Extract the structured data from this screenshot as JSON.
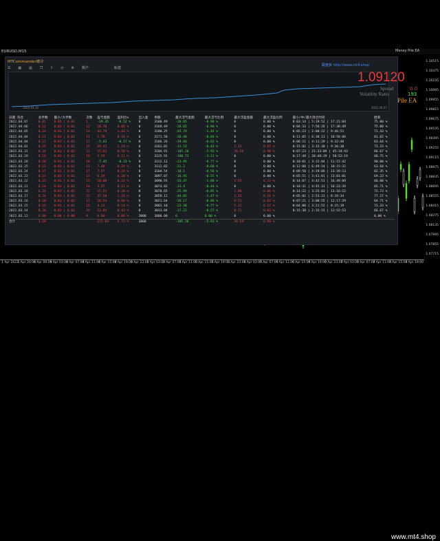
{
  "window": {
    "symbol_title": "EURUSD,M15",
    "ea_title": "Money Pile EA"
  },
  "panel": {
    "title": "MTCommander统计",
    "toolbar": [
      "账户",
      "轨迹"
    ],
    "mini_chart_start": "2022.03.14",
    "mini_chart_end": "2022.04.07",
    "link_text": "跟盘板 http://www.mt4.shop"
  },
  "ea_overlay": {
    "price": "1.09120",
    "spread_label": "Spread",
    "spread_value": "0.0",
    "volatility_label": "Volatility Ratio",
    "volatility_value": "193",
    "name": "Pile EA"
  },
  "table": {
    "headers": [
      "日期\n符合",
      "总手数",
      "最小/大手数",
      "次数",
      "盈亏金额",
      "盈利比%",
      "出入金",
      "余额",
      "最大浮亏金额",
      "最大浮亏比例",
      "最大浮盈金额",
      "最大浮盈比例",
      "最小/中/最大持仓时间",
      "胜率"
    ],
    "rows": [
      [
        "2022.04.07",
        "0.01",
        "0.01 | 0.01",
        "1",
        "-19.45",
        "-0.52 %",
        "0",
        "3180.49",
        "-28.65",
        "-0.90 %",
        "0",
        "0.00 %",
        "0:03:14 | 5:19:52 | 17:21:04",
        "75.00 %"
      ],
      [
        "2022.04.06",
        "0.12",
        "0.01 | 0.01",
        "12",
        "28.70",
        "0.86 %",
        "0",
        "3169.49",
        "-28.65",
        "-0.90 %",
        "0",
        "0.00 %",
        "0:04:33 | 7:56:26 | 17:38:49",
        "75.00 %"
      ],
      [
        "2022.04.05",
        "0.14",
        "0.01 | 0.01",
        "14",
        "44.79",
        "1.43 %",
        "0",
        "3180.25",
        "-45.79",
        "-1.44 %",
        "0",
        "0.00 %",
        "0:05:23 | 2:08:22 | 9:46:51",
        "71.43 %"
      ],
      [
        "2022.04.04",
        "0.11",
        "0.01 | 0.01",
        "11",
        "5.78",
        "0.18 %",
        "0",
        "3171.58",
        "-26.48",
        "-0.84 %",
        "0",
        "0.00 %",
        "0:11:05 | 6:38:13 | 18:50:06",
        "81.82 %"
      ],
      [
        "2022.04.04",
        "0.11",
        "0.01 | 0.01",
        "11",
        "-5.43",
        "-0.17 %",
        "0",
        "3166.26",
        "-19.66",
        "-0.62 %",
        "0",
        "0.00 %",
        "0:06:11 | 4:11:29 | 9:32:40",
        "63.64 %"
      ],
      [
        "2022.04.01",
        "0.15",
        "0.01 | 0.01",
        "15",
        "69.42",
        "2.19 %",
        "0",
        "3161.02",
        "-13.53",
        "-0.43 %",
        "2.15",
        "0.07 %",
        "0:15:01 | 3:15:30 | 9:30:30",
        "73.33 %"
      ],
      [
        "2022.03.31",
        "0.24",
        "0.01 | 0.02",
        "21",
        "15.62",
        "0.50 %",
        "0",
        "3104.91",
        "-185.26",
        "-5.93 %",
        "30.59",
        "0.98 %",
        "0:07:23 | 21:33:09 | 45:34:43",
        "66.67 %"
      ],
      [
        "2022.03.29",
        "0.16",
        "0.01 | 0.01",
        "16",
        "3.59",
        "0.11 %",
        "0",
        "3125.91",
        "-100.73",
        "-3.21 %",
        "0",
        "0.00 %",
        "0:17:48 | 28:48:19 | 58:52:19",
        "68.75 %"
      ],
      [
        "2022.03.28",
        "0.10",
        "0.01 | 0.01",
        "10",
        "-7.45",
        "-0.23 %",
        "0",
        "3122.12",
        "-23.95",
        "-0.77 %",
        "0",
        "0.00 %",
        "0:10:01 | 3:12:04 | 11:15:42",
        "90.00 %"
      ],
      [
        "2022.03.25",
        "0.12",
        "0.01 | 0.02",
        "11",
        "7.48",
        "0.24 %",
        "0",
        "3112.82",
        "-21.2",
        "-0.68 %",
        "0",
        "0.00 %",
        "0:12:00 | 6:49:14 | 18:15:32",
        "63.64 %"
      ],
      [
        "2022.03.24",
        "0.17",
        "0.01 | 0.01",
        "17",
        "7.47",
        "0.24 %",
        "0",
        "3104.54",
        "-18.1",
        "-0.58 %",
        "0",
        "0.00 %",
        "0:09:50 | 4:29:06 | 13:39:13",
        "82.35 %"
      ],
      [
        "2022.03.23",
        "0.13",
        "0.01 | 0.01",
        "13",
        "6.19",
        "0.20 %",
        "0",
        "3097.07",
        "-16.91",
        "-0.55 %",
        "0",
        "0.00 %",
        "0:05:51 | 3:41:01 | 13:01:01",
        "69.23 %"
      ],
      [
        "2022.03.22",
        "0.15",
        "0.01 | 0.01",
        "15",
        "10.08",
        "0.33 %",
        "0",
        "3090.91",
        "-33.47",
        "-1.08 %",
        "3.55",
        "0.12 %",
        "0:14:07 | 4:42:51 | 16:49:09",
        "60.00 %"
      ],
      [
        "2022.03.21",
        "0.14",
        "0.01 | 0.01",
        "14",
        "3.37",
        "0.11 %",
        "0",
        "3074.82",
        "-13.4",
        "-0.44 %",
        "0",
        "0.00 %",
        "0:10:31 | 4:45:31 | 16:23:39",
        "85.71 %"
      ],
      [
        "2022.03.18",
        "0.24",
        "0.01 | 0.02",
        "22",
        "11.53",
        "0.38 %",
        "0",
        "3070.65",
        "-25.99",
        "-0.85 %",
        "1.88",
        "0.06 %",
        "0:14:22 | 3:25:03 | 13:16:12",
        "72.73 %"
      ],
      [
        "2022.03.17",
        "0.24",
        "0.01 | 0.02",
        "22",
        "37.58",
        "1.24 %",
        "0",
        "3059.12",
        "-44.85",
        "-1.47 %",
        "3.33",
        "0.11 %",
        "0:05:01 | 2:53:23 | 8:19:34",
        "77.27 %"
      ],
      [
        "2022.03.16",
        "0.18",
        "0.01 | 0.02",
        "17",
        "20.54",
        "0.68 %",
        "0",
        "3021.64",
        "-26.17",
        "-0.86 %",
        "0.72",
        "0.02 %",
        "0:07:21 | 3:00:55 | 12:17:29",
        "64.71 %"
      ],
      [
        "2022.03.15",
        "0.15",
        "0.01 | 0.01",
        "15",
        "4.23",
        "0.14 %",
        "0",
        "3001.10",
        "-23.38",
        "-0.77 %",
        "5.15",
        "0.17 %",
        "0:04:00 | 3:21:52 | 8:15:19",
        "73.33 %"
      ],
      [
        "2022.03.14",
        "0.26",
        "0.01 | 0.02",
        "24",
        "12.84",
        "0.43 %",
        "0",
        "3013.84",
        "-17.22",
        "-0.57 %",
        "0.72",
        "0.02 %",
        "0:15:30 | 2:35:15 | 12:52:53",
        "66.67 %"
      ],
      [
        "2022.03.12",
        "0.00",
        "0.00 | 0.00",
        "0",
        "0.00",
        "0.00 %",
        "3000",
        "3000.00",
        "0",
        "0.00 %",
        "0",
        "0.00 %",
        "",
        "0.00 %"
      ]
    ],
    "total": [
      "合计",
      "3.18",
      "",
      "",
      "172.84",
      "5.73 %",
      "3000",
      "",
      "-185.26",
      "-5.93 %",
      "30.59",
      "0.98 %",
      "",
      ""
    ]
  },
  "price_scale": [
    "1.10515",
    "1.10375",
    "1.10235",
    "1.10095",
    "1.09955",
    "1.09815",
    "1.09675",
    "1.09535",
    "1.09395",
    "1.09255",
    "1.09115",
    "1.08975",
    "1.08835",
    "1.08695",
    "1.08555",
    "1.08415",
    "1.08275",
    "1.08135",
    "1.07995",
    "1.07855",
    "1.07715"
  ],
  "time_axis": [
    "1 Apr 2022",
    "1 Apr 20:00",
    "4 Apr 00:00",
    "4 Apr 03:00",
    "4 Apr 07:00",
    "4 Apr 11:00",
    "4 Apr 15:00",
    "4 Apr 19:00",
    "4 Apr 23:00",
    "5 Apr 03:00",
    "5 Apr 07:00",
    "5 Apr 11:00",
    "5 Apr 15:00",
    "5 Apr 19:00",
    "5 Apr 23:00",
    "6 Apr 03:00",
    "6 Apr 07:00",
    "6 Apr 11:00",
    "6 Apr 15:00",
    "6 Apr 19:00",
    "6 Apr 23:00",
    "7 Apr 03:00",
    "7 Apr 07:00",
    "7 Apr 11:00",
    "7 Apr 15:00",
    "7 Apr 19:00"
  ],
  "watermark": "www.mt4.shop",
  "colors": {
    "profit": "#4ce24c",
    "loss": "#e84a4a",
    "accent": "#e8a23c",
    "panel_bg": "#1a1d22"
  }
}
